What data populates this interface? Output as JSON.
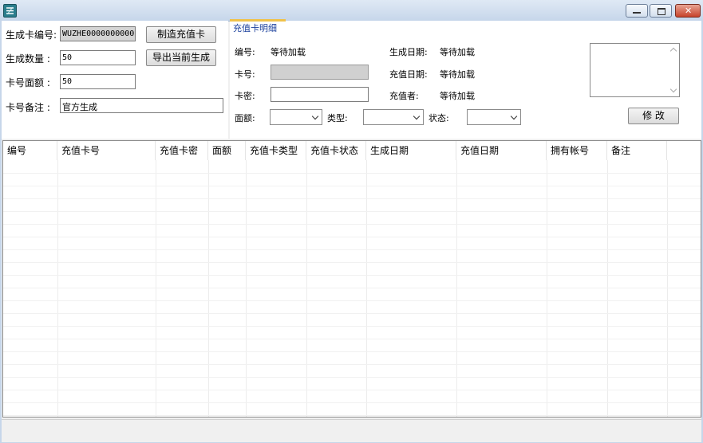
{
  "window": {
    "minimize_glyph": "—",
    "maximize_glyph": "▢",
    "close_glyph": "✕"
  },
  "generator": {
    "card_code_label": "生成卡编号:",
    "card_code_value": "WUZHE0000000000",
    "quantity_label": "生成数量  :",
    "quantity_value": "50",
    "face_value_label": "卡号面额  :",
    "face_value_value": "50",
    "remark_label": "卡号备注  :",
    "remark_value": "官方生成",
    "make_button": "制造充值卡",
    "export_button": "导出当前生成"
  },
  "detail": {
    "group_title": "充值卡明细",
    "id_label": "编号:",
    "id_value": "等待加载",
    "card_no_label": "卡号:",
    "password_label": "卡密:",
    "create_date_label": "生成日期:",
    "create_date_value": "等待加载",
    "recharge_date_label": "充值日期:",
    "recharge_date_value": "等待加载",
    "recharger_label": "充值者:",
    "recharger_value": "等待加载",
    "amount_label": "面额:",
    "type_label": "类型:",
    "status_label": "状态:",
    "modify_button": "修 改"
  },
  "grid": {
    "columns": [
      {
        "key": "id",
        "label": "编号"
      },
      {
        "key": "card_no",
        "label": "充值卡号"
      },
      {
        "key": "card_pwd",
        "label": "充值卡密"
      },
      {
        "key": "amount",
        "label": "面额"
      },
      {
        "key": "type",
        "label": "充值卡类型"
      },
      {
        "key": "status",
        "label": "充值卡状态"
      },
      {
        "key": "create_date",
        "label": "生成日期"
      },
      {
        "key": "recharge_date",
        "label": "充值日期"
      },
      {
        "key": "account",
        "label": "拥有帐号"
      },
      {
        "key": "remark",
        "label": "备注"
      }
    ],
    "rows": []
  },
  "colors": {
    "group_title": "#1a3f9c",
    "group_accent": "#f0c24a",
    "close_button": "#c7432a"
  },
  "icons": {
    "app": "app-logo-icon",
    "dropdown": "chevron-down-icon"
  }
}
